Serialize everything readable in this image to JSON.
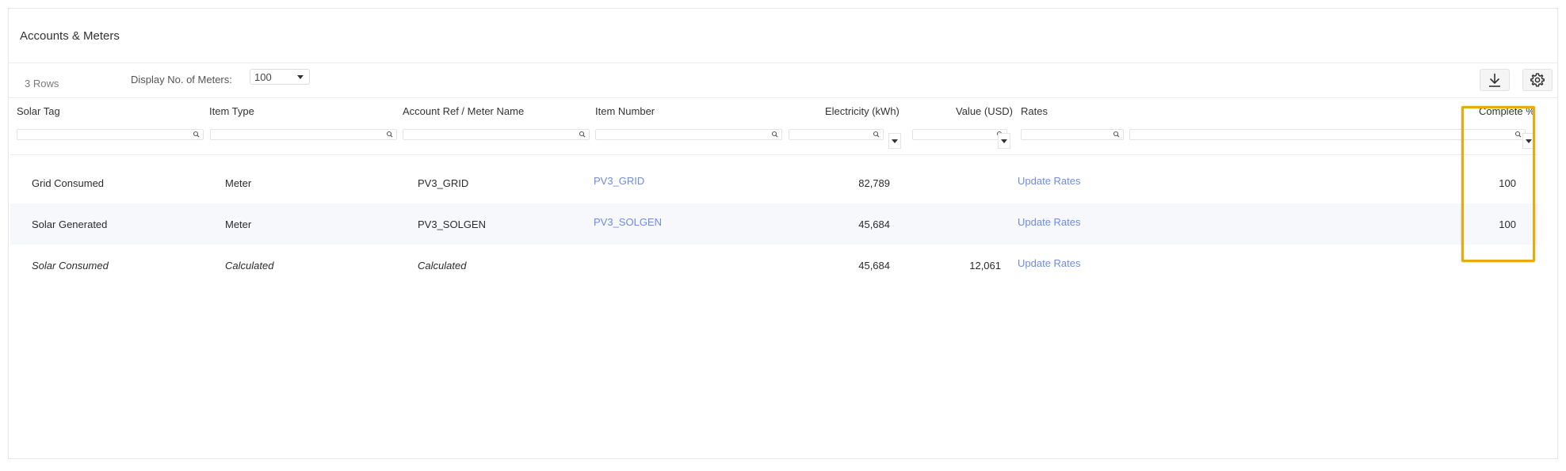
{
  "panel": {
    "title": "Accounts & Meters"
  },
  "toolbar": {
    "row_count": "3 Rows",
    "display_label": "Display No. of Meters:",
    "display_value": "100",
    "download_icon": "download-icon",
    "settings_icon": "gear-icon"
  },
  "columns": [
    {
      "key": "solar_tag",
      "label": "Solar Tag"
    },
    {
      "key": "item_type",
      "label": "Item Type"
    },
    {
      "key": "account_ref",
      "label": "Account Ref / Meter Name"
    },
    {
      "key": "item_number",
      "label": "Item Number"
    },
    {
      "key": "electricity",
      "label": "Electricity (kWh)"
    },
    {
      "key": "value",
      "label": "Value (USD)"
    },
    {
      "key": "rates",
      "label": "Rates"
    },
    {
      "key": "complete",
      "label": "Complete %"
    }
  ],
  "rows": [
    {
      "solar_tag": "Grid Consumed",
      "item_type": "Meter",
      "account_ref": "PV3_GRID",
      "item_number": "PV3_GRID",
      "electricity": "82,789",
      "value": "",
      "rates": "Update Rates",
      "complete": "100"
    },
    {
      "solar_tag": "Solar Generated",
      "item_type": "Meter",
      "account_ref": "PV3_SOLGEN",
      "item_number": "PV3_SOLGEN",
      "electricity": "45,684",
      "value": "",
      "rates": "Update Rates",
      "complete": "100"
    },
    {
      "solar_tag": "Solar Consumed",
      "item_type": "Calculated",
      "account_ref": "Calculated",
      "item_number": "",
      "electricity": "45,684",
      "value": "12,061",
      "rates": "Update Rates",
      "complete": ""
    }
  ],
  "colors": {
    "link": "#6f8be0",
    "highlight": "#e5ad0b",
    "alt_row": "#f6f8fc"
  }
}
